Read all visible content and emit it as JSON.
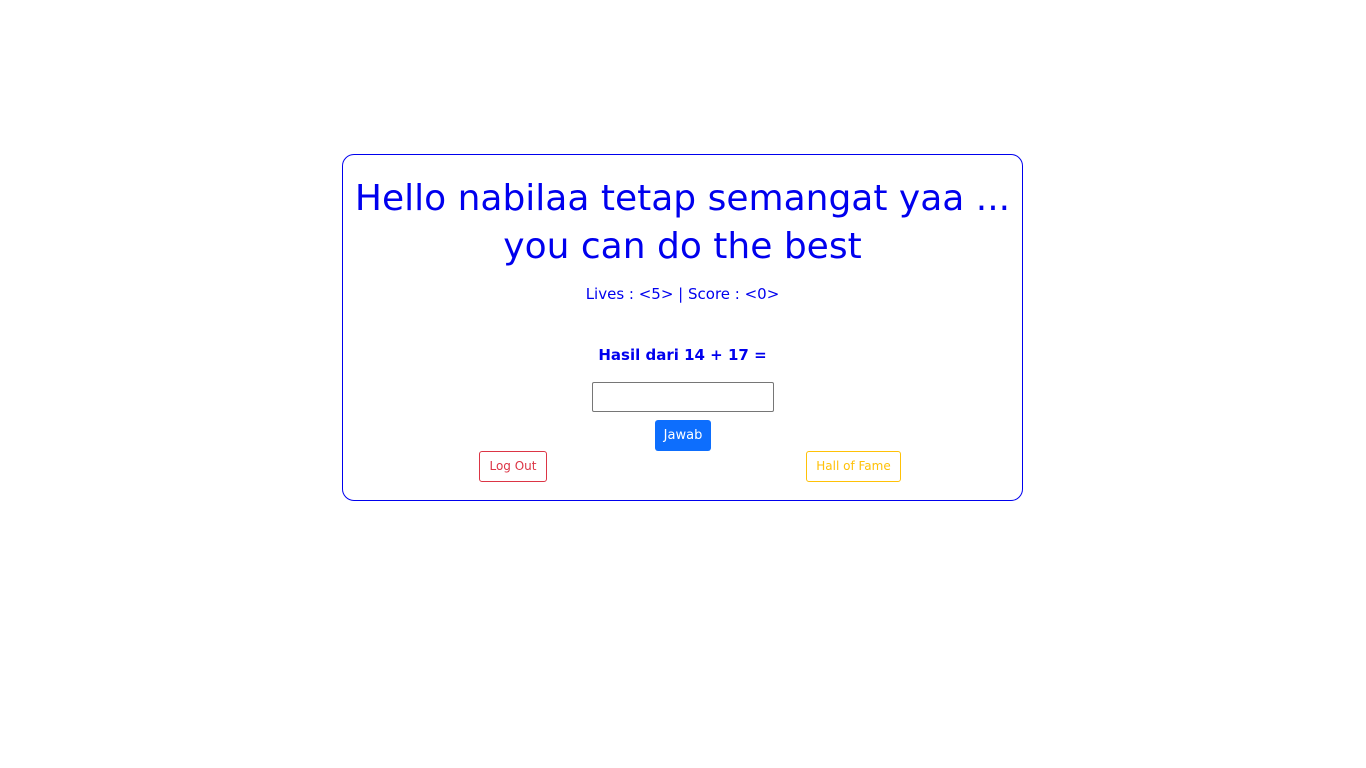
{
  "game": {
    "greeting_line1": "Hello nabilaa tetap semangat yaa ...",
    "greeting_line2": "you can do the best",
    "stats": "Lives : <5> | Score : <0>",
    "question": "Hasil dari 14 + 17 =",
    "answer_value": "",
    "answer_placeholder": "",
    "submit_label": "Jawab",
    "logout_label": "Log Out",
    "hall_of_fame_label": "Hall of Fame"
  },
  "colors": {
    "accent": "#0000ee",
    "primary_button": "#0d6efd",
    "danger": "#dc3545",
    "warning": "#ffc107"
  }
}
